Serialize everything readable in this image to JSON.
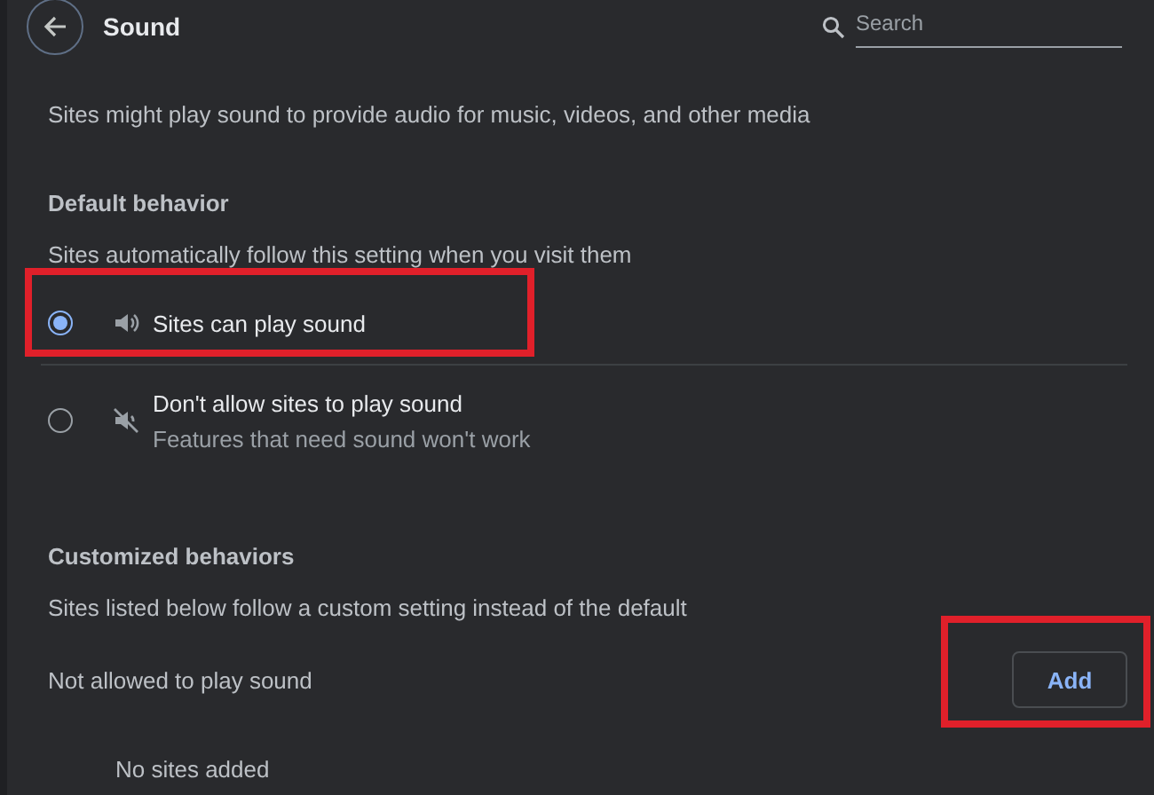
{
  "header": {
    "title": "Sound",
    "search": {
      "placeholder": "Search"
    }
  },
  "description": "Sites might play sound to provide audio for music, videos, and other media",
  "default_behavior": {
    "heading": "Default behavior",
    "subtitle": "Sites automatically follow this setting when you visit them",
    "options": [
      {
        "kind": "sound",
        "label": "Sites can play sound",
        "selected": true,
        "highlighted": true
      },
      {
        "kind": "muted",
        "label": "Don't allow sites to play sound",
        "sublabel": "Features that need sound won't work",
        "selected": false,
        "highlighted": false
      }
    ]
  },
  "customized": {
    "heading": "Customized behaviors",
    "subtitle": "Sites listed below follow a custom setting instead of the default",
    "list": {
      "label": "Not allowed to play sound",
      "button": {
        "label": "Add",
        "highlighted": true
      },
      "empty": "No sites added"
    }
  }
}
